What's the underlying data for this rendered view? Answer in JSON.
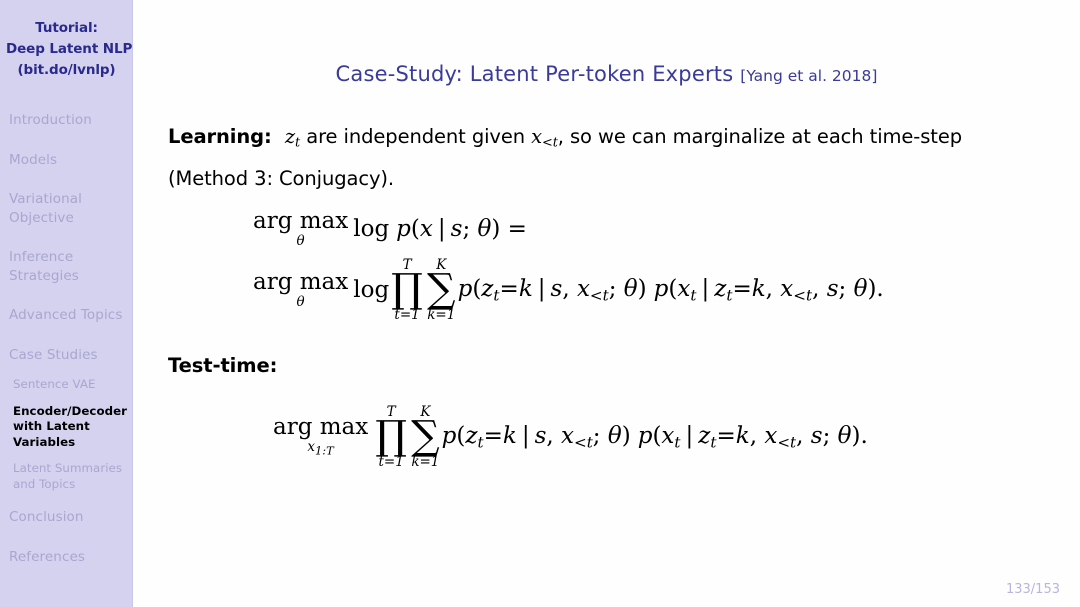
{
  "sidebar": {
    "title_lines": [
      "Tutorial:",
      "Deep Latent NLP",
      "(bit.do/lvnlp)"
    ],
    "sections": [
      {
        "label": "Introduction",
        "active": false
      },
      {
        "label": "Models",
        "active": false
      },
      {
        "label": "Variational Objective",
        "active": false
      },
      {
        "label": "Inference Strategies",
        "active": false
      },
      {
        "label": "Advanced Topics",
        "active": false
      },
      {
        "label": "Case Studies",
        "active": false
      },
      {
        "label": "Conclusion",
        "active": false
      },
      {
        "label": "References",
        "active": false
      }
    ],
    "subsections": [
      {
        "label": "Sentence VAE",
        "active": false
      },
      {
        "label": "Encoder/Decoder with Latent Variables",
        "active": true
      },
      {
        "label": "Latent Summaries and Topics",
        "active": false
      }
    ],
    "colors": {
      "background": "#d4d2ef",
      "title_text": "#2a2a8c",
      "inactive_text": "#a9a7cf",
      "active_text": "#000000"
    }
  },
  "slide": {
    "title_main": "Case-Study: Latent Per-token Experts",
    "title_citation": "[Yang et al. 2018]",
    "title_color": "#3a3a99",
    "page_number": "133/153",
    "learning_label": "Learning:",
    "learning_text_1": "are independent given",
    "learning_text_2": ", so we can marginalize at each time-step",
    "learning_text_3": "(Method 3: Conjugacy).",
    "learning_var_z": "z",
    "learning_var_z_sub": "t",
    "learning_var_x": "x",
    "learning_var_x_sub": "<t",
    "test_time_label": "Test-time:"
  },
  "equations": {
    "eq1": {
      "argmax": "arg max",
      "argmax_sub": "θ",
      "log": "log",
      "body": "p(x | s; θ) ="
    },
    "eq2": {
      "argmax": "arg max",
      "argmax_sub": "θ",
      "log": "log",
      "prod_glyph": "∏",
      "prod_top": "T",
      "prod_bottom": "t=1",
      "sum_glyph": "∑",
      "sum_top": "K",
      "sum_bottom": "k=1",
      "factor1": "p(z_t=k | s, x_<t; θ)",
      "factor2": "p(x_t | z_t=k, x_<t, s; θ)."
    },
    "eq3": {
      "argmax": "arg max",
      "argmax_sub": "x_1:T",
      "prod_glyph": "∏",
      "prod_top": "T",
      "prod_bottom": "t=1",
      "sum_glyph": "∑",
      "sum_top": "K",
      "sum_bottom": "k=1",
      "factor1": "p(z_t=k | s, x_<t; θ)",
      "factor2": "p(x_t | z_t=k, x_<t, s; θ)."
    }
  }
}
